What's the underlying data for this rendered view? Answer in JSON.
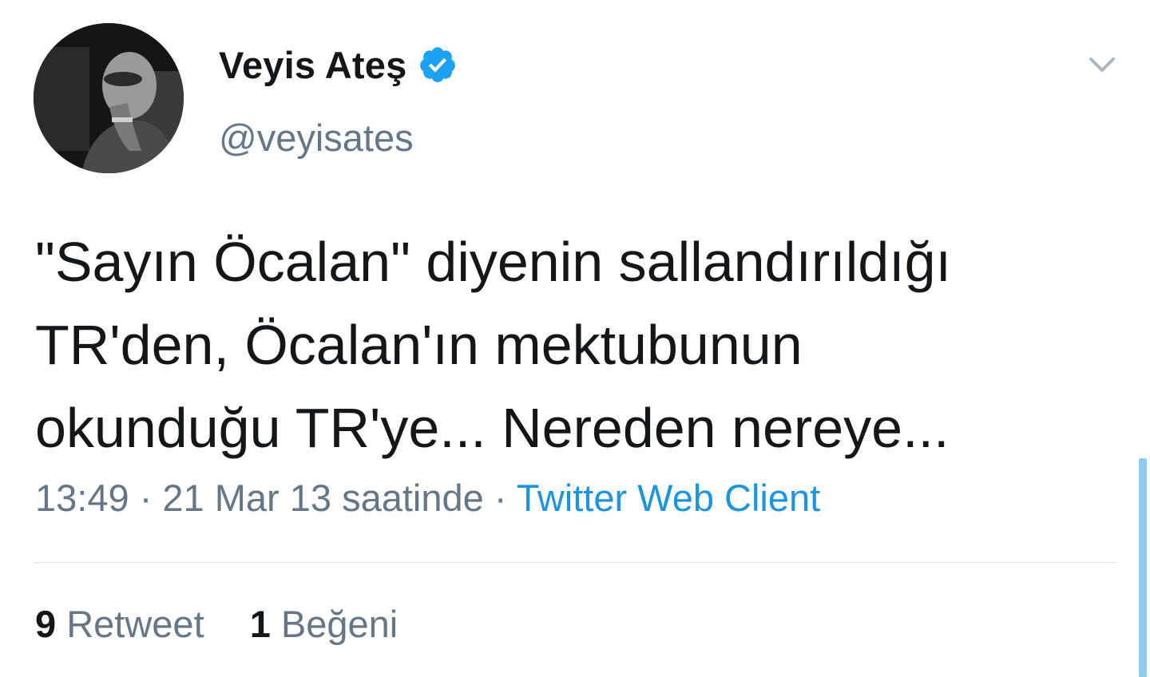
{
  "user": {
    "display_name": "Veyis Ateş",
    "handle": "@veyisates",
    "verified": true,
    "avatar_icon": "profile-photo"
  },
  "tweet": {
    "text_lines": [
      "\"Sayın Öcalan\" diyenin sallandırıldığı",
      "TR'den, Öcalan'ın mektubunun",
      "okunduğu TR'ye... Nereden nereye..."
    ],
    "time": "13:49",
    "separator": "·",
    "date": "21 Mar 13 saatinde",
    "source": "Twitter Web Client"
  },
  "stats": {
    "retweet_count": "9",
    "retweet_label": "Retweet",
    "like_count": "1",
    "like_label": "Beğeni"
  },
  "colors": {
    "text_primary": "#14171a",
    "text_secondary": "#657786",
    "link": "#1b95e0",
    "verified_badge": "#1da1f2",
    "divider": "#dfe3e6",
    "scrollbar": "#8fcaf0"
  },
  "icons": {
    "verified": "verified-badge-icon",
    "menu": "chevron-down-icon"
  }
}
